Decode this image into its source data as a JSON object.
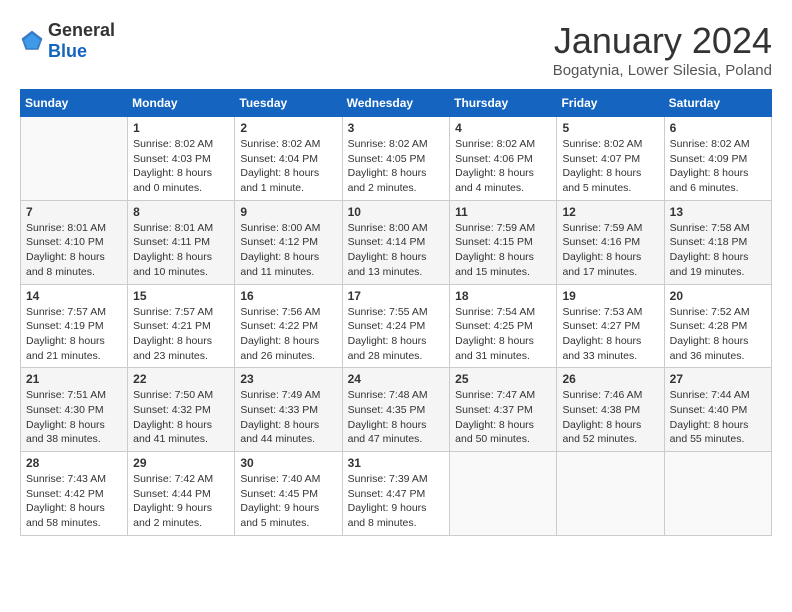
{
  "header": {
    "logo_general": "General",
    "logo_blue": "Blue",
    "month_title": "January 2024",
    "subtitle": "Bogatynia, Lower Silesia, Poland"
  },
  "days_of_week": [
    "Sunday",
    "Monday",
    "Tuesday",
    "Wednesday",
    "Thursday",
    "Friday",
    "Saturday"
  ],
  "weeks": [
    [
      {
        "day": "",
        "info": ""
      },
      {
        "day": "1",
        "info": "Sunrise: 8:02 AM\nSunset: 4:03 PM\nDaylight: 8 hours\nand 0 minutes."
      },
      {
        "day": "2",
        "info": "Sunrise: 8:02 AM\nSunset: 4:04 PM\nDaylight: 8 hours\nand 1 minute."
      },
      {
        "day": "3",
        "info": "Sunrise: 8:02 AM\nSunset: 4:05 PM\nDaylight: 8 hours\nand 2 minutes."
      },
      {
        "day": "4",
        "info": "Sunrise: 8:02 AM\nSunset: 4:06 PM\nDaylight: 8 hours\nand 4 minutes."
      },
      {
        "day": "5",
        "info": "Sunrise: 8:02 AM\nSunset: 4:07 PM\nDaylight: 8 hours\nand 5 minutes."
      },
      {
        "day": "6",
        "info": "Sunrise: 8:02 AM\nSunset: 4:09 PM\nDaylight: 8 hours\nand 6 minutes."
      }
    ],
    [
      {
        "day": "7",
        "info": "Sunrise: 8:01 AM\nSunset: 4:10 PM\nDaylight: 8 hours\nand 8 minutes."
      },
      {
        "day": "8",
        "info": "Sunrise: 8:01 AM\nSunset: 4:11 PM\nDaylight: 8 hours\nand 10 minutes."
      },
      {
        "day": "9",
        "info": "Sunrise: 8:00 AM\nSunset: 4:12 PM\nDaylight: 8 hours\nand 11 minutes."
      },
      {
        "day": "10",
        "info": "Sunrise: 8:00 AM\nSunset: 4:14 PM\nDaylight: 8 hours\nand 13 minutes."
      },
      {
        "day": "11",
        "info": "Sunrise: 7:59 AM\nSunset: 4:15 PM\nDaylight: 8 hours\nand 15 minutes."
      },
      {
        "day": "12",
        "info": "Sunrise: 7:59 AM\nSunset: 4:16 PM\nDaylight: 8 hours\nand 17 minutes."
      },
      {
        "day": "13",
        "info": "Sunrise: 7:58 AM\nSunset: 4:18 PM\nDaylight: 8 hours\nand 19 minutes."
      }
    ],
    [
      {
        "day": "14",
        "info": "Sunrise: 7:57 AM\nSunset: 4:19 PM\nDaylight: 8 hours\nand 21 minutes."
      },
      {
        "day": "15",
        "info": "Sunrise: 7:57 AM\nSunset: 4:21 PM\nDaylight: 8 hours\nand 23 minutes."
      },
      {
        "day": "16",
        "info": "Sunrise: 7:56 AM\nSunset: 4:22 PM\nDaylight: 8 hours\nand 26 minutes."
      },
      {
        "day": "17",
        "info": "Sunrise: 7:55 AM\nSunset: 4:24 PM\nDaylight: 8 hours\nand 28 minutes."
      },
      {
        "day": "18",
        "info": "Sunrise: 7:54 AM\nSunset: 4:25 PM\nDaylight: 8 hours\nand 31 minutes."
      },
      {
        "day": "19",
        "info": "Sunrise: 7:53 AM\nSunset: 4:27 PM\nDaylight: 8 hours\nand 33 minutes."
      },
      {
        "day": "20",
        "info": "Sunrise: 7:52 AM\nSunset: 4:28 PM\nDaylight: 8 hours\nand 36 minutes."
      }
    ],
    [
      {
        "day": "21",
        "info": "Sunrise: 7:51 AM\nSunset: 4:30 PM\nDaylight: 8 hours\nand 38 minutes."
      },
      {
        "day": "22",
        "info": "Sunrise: 7:50 AM\nSunset: 4:32 PM\nDaylight: 8 hours\nand 41 minutes."
      },
      {
        "day": "23",
        "info": "Sunrise: 7:49 AM\nSunset: 4:33 PM\nDaylight: 8 hours\nand 44 minutes."
      },
      {
        "day": "24",
        "info": "Sunrise: 7:48 AM\nSunset: 4:35 PM\nDaylight: 8 hours\nand 47 minutes."
      },
      {
        "day": "25",
        "info": "Sunrise: 7:47 AM\nSunset: 4:37 PM\nDaylight: 8 hours\nand 50 minutes."
      },
      {
        "day": "26",
        "info": "Sunrise: 7:46 AM\nSunset: 4:38 PM\nDaylight: 8 hours\nand 52 minutes."
      },
      {
        "day": "27",
        "info": "Sunrise: 7:44 AM\nSunset: 4:40 PM\nDaylight: 8 hours\nand 55 minutes."
      }
    ],
    [
      {
        "day": "28",
        "info": "Sunrise: 7:43 AM\nSunset: 4:42 PM\nDaylight: 8 hours\nand 58 minutes."
      },
      {
        "day": "29",
        "info": "Sunrise: 7:42 AM\nSunset: 4:44 PM\nDaylight: 9 hours\nand 2 minutes."
      },
      {
        "day": "30",
        "info": "Sunrise: 7:40 AM\nSunset: 4:45 PM\nDaylight: 9 hours\nand 5 minutes."
      },
      {
        "day": "31",
        "info": "Sunrise: 7:39 AM\nSunset: 4:47 PM\nDaylight: 9 hours\nand 8 minutes."
      },
      {
        "day": "",
        "info": ""
      },
      {
        "day": "",
        "info": ""
      },
      {
        "day": "",
        "info": ""
      }
    ]
  ]
}
